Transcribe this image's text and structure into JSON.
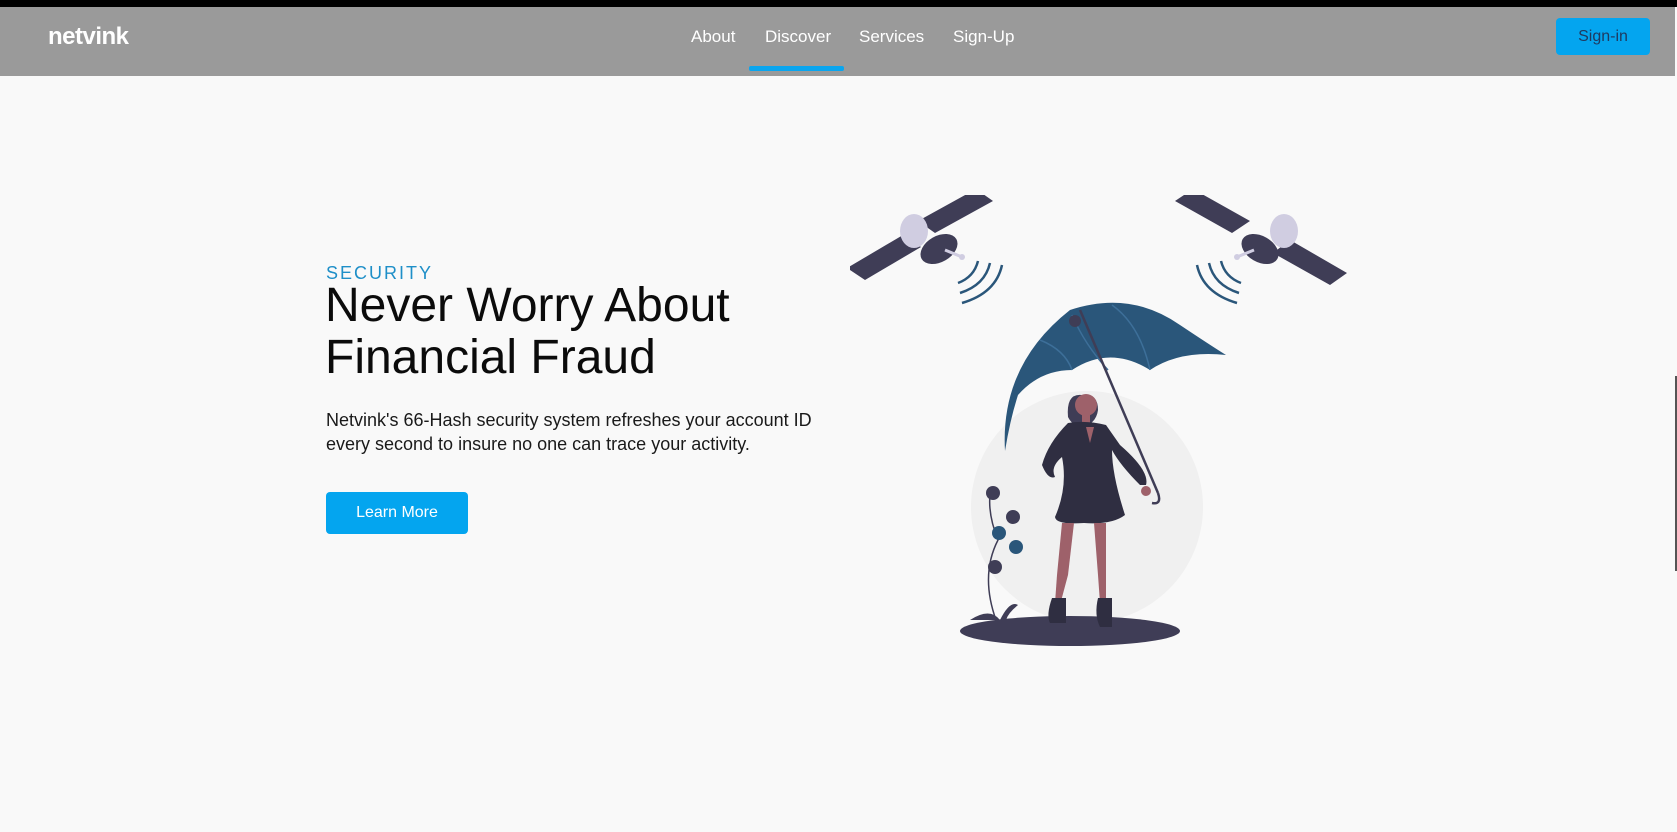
{
  "navbar": {
    "logo": "netvink",
    "links": [
      {
        "label": "About"
      },
      {
        "label": "Discover",
        "active": true
      },
      {
        "label": "Services"
      },
      {
        "label": "Sign-Up"
      }
    ],
    "signin_label": "Sign-in"
  },
  "hero": {
    "eyebrow": "SECURITY",
    "headline_line1": "Never Worry About",
    "headline_line2": "Financial Fraud",
    "description_line1": "Netvink's 66-Hash security system refreshes your account ID",
    "description_line2": "every second to insure no one can trace your activity.",
    "cta_label": "Learn More"
  },
  "colors": {
    "accent": "#04a5ef",
    "eyebrow": "#1e8fc8",
    "navbar_bg": "#9a9a9a",
    "illustration_dark": "#3f3d56",
    "illustration_blue": "#2a567a"
  },
  "icons": [
    "satellite-icon",
    "signal-waves-icon"
  ]
}
